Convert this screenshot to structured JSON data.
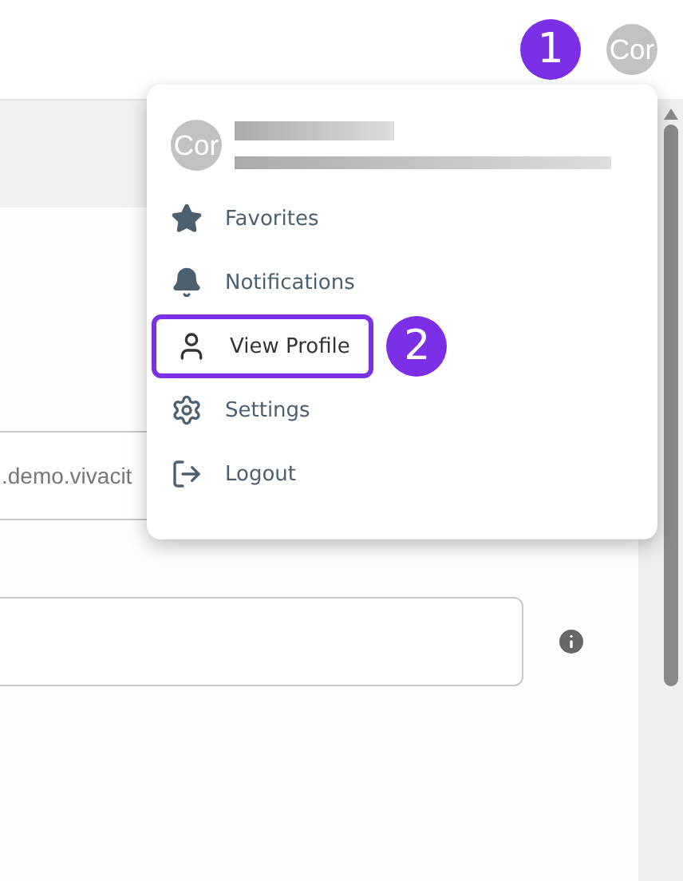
{
  "top_bar": {
    "step_badge": "1",
    "avatar_text": "Cor"
  },
  "form": {
    "fields": [
      {
        "value": ".demo.vivacit",
        "info": false
      },
      {
        "info": true
      }
    ]
  },
  "user_menu": {
    "avatar_text": "Cor",
    "items": [
      {
        "kind": "star",
        "label": "Favorites",
        "highlighted": false
      },
      {
        "kind": "bell",
        "label": "Notifications",
        "highlighted": false
      },
      {
        "kind": "person",
        "label": "View Profile",
        "highlighted": true,
        "step_badge": "2"
      },
      {
        "kind": "gear",
        "label": "Settings",
        "highlighted": false
      },
      {
        "kind": "logout",
        "label": "Logout",
        "highlighted": false
      }
    ]
  }
}
